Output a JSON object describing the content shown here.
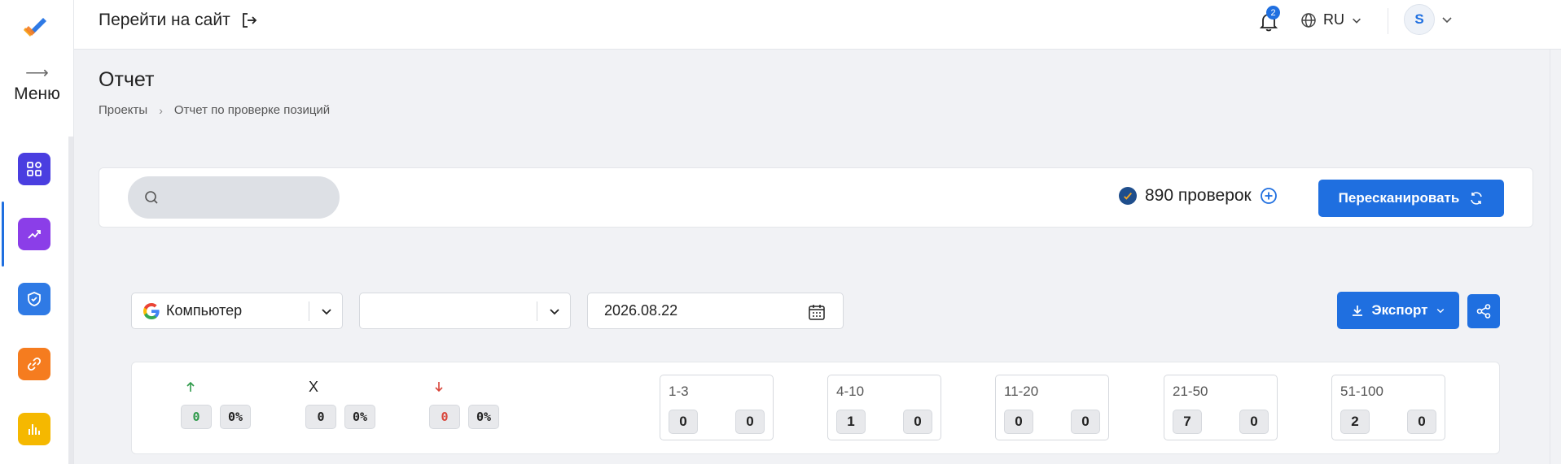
{
  "header": {
    "goto_site": "Перейти на сайт",
    "notifications_count": "2",
    "language": "RU",
    "avatar_initial": "S"
  },
  "sidebar": {
    "menu_label": "Меню",
    "items": [
      {
        "name": "dashboard",
        "color": "#4a3ee0"
      },
      {
        "name": "positions",
        "color": "#8b3ee8"
      },
      {
        "name": "security",
        "color": "#2f7ae5"
      },
      {
        "name": "links",
        "color": "#f57c1f"
      },
      {
        "name": "analytics",
        "color": "#f5b800"
      }
    ]
  },
  "page": {
    "title": "Отчет",
    "breadcrumb": [
      "Проекты",
      "Отчет по проверке позиций"
    ]
  },
  "toolbar": {
    "search_value": "",
    "checks_label": "890 проверок",
    "rescan_label": "Пересканировать"
  },
  "filters": {
    "device": "Компьютер",
    "second_select": "",
    "date": "2026.08.22",
    "export_label": "Экспорт"
  },
  "stats": {
    "trends": [
      {
        "name": "up",
        "symbol": "↑",
        "color": "#2e9a4a",
        "count": "0",
        "percent": "0%"
      },
      {
        "name": "unchanged",
        "symbol": "X",
        "color": "#222222",
        "count": "0",
        "percent": "0%"
      },
      {
        "name": "down",
        "symbol": "↓",
        "color": "#d9453a",
        "count": "0",
        "percent": "0%"
      }
    ],
    "ranges": [
      {
        "label": "1-3",
        "left": "0",
        "right": "0"
      },
      {
        "label": "4-10",
        "left": "1",
        "right": "0"
      },
      {
        "label": "11-20",
        "left": "0",
        "right": "0"
      },
      {
        "label": "21-50",
        "left": "7",
        "right": "0"
      },
      {
        "label": "51-100",
        "left": "2",
        "right": "0"
      }
    ]
  }
}
